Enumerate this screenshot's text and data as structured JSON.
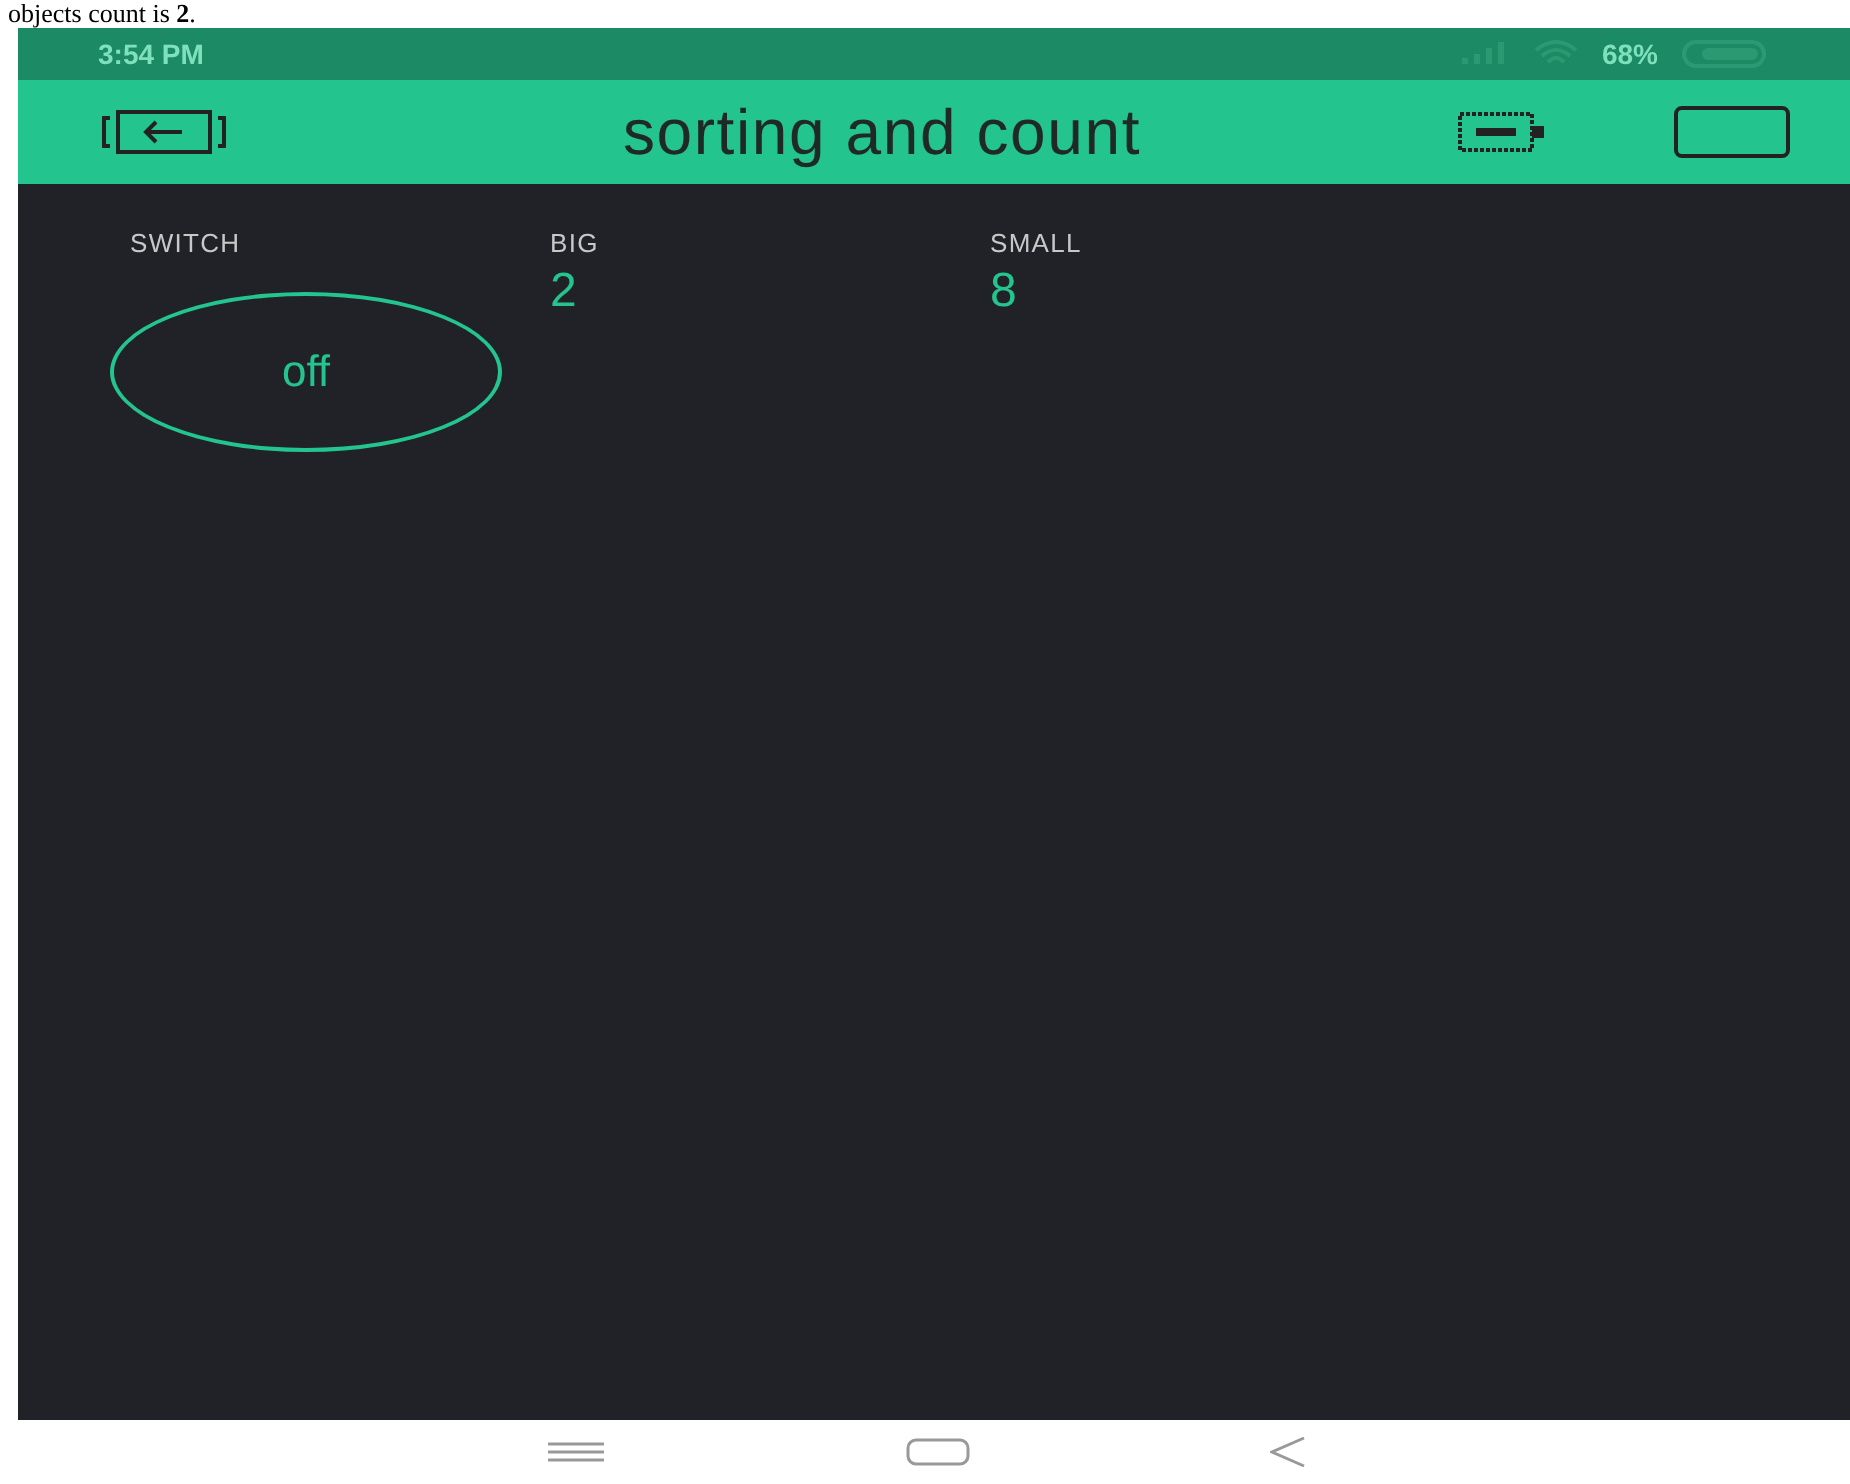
{
  "document_text": "objects count is **2**.",
  "status_bar": {
    "time": "3:54 PM",
    "battery": "68%"
  },
  "header": {
    "title": "sorting and count"
  },
  "widgets": [
    {
      "kind": "switch",
      "label": "SWITCH",
      "text": "off",
      "on": false
    },
    {
      "kind": "value",
      "label": "BIG",
      "value": "2"
    },
    {
      "kind": "value",
      "label": "SMALL",
      "value": "8"
    }
  ]
}
